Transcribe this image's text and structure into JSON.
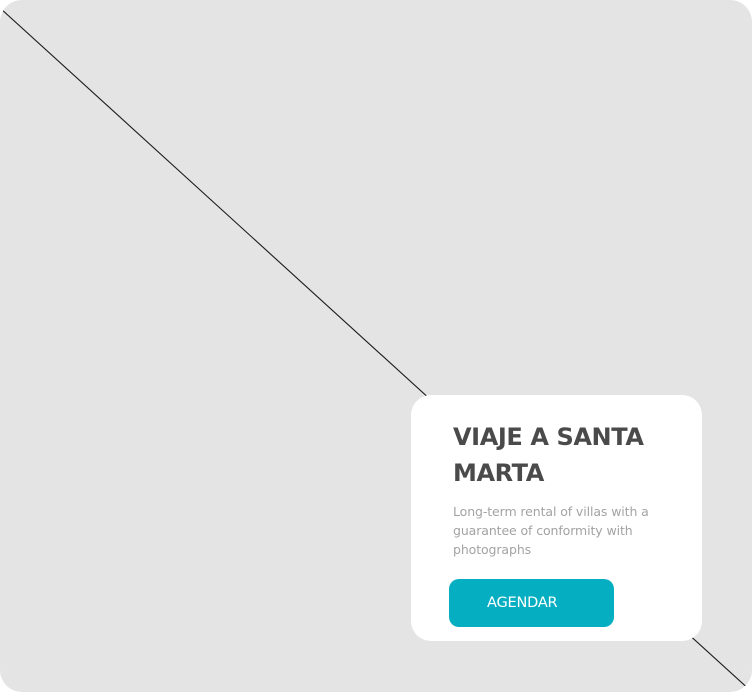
{
  "card": {
    "title": "VIAJE A SANTA MARTA",
    "description": "Long-term rental of villas with a guarantee of conformity with photographs",
    "button_label": "AGENDAR"
  },
  "colors": {
    "image_placeholder": "#e4e4e4",
    "card_background": "#ffffff",
    "title_text": "#4a4a4a",
    "description_text": "#a3a3a3",
    "button_background": "#06aec2",
    "button_text": "#ffffff"
  }
}
